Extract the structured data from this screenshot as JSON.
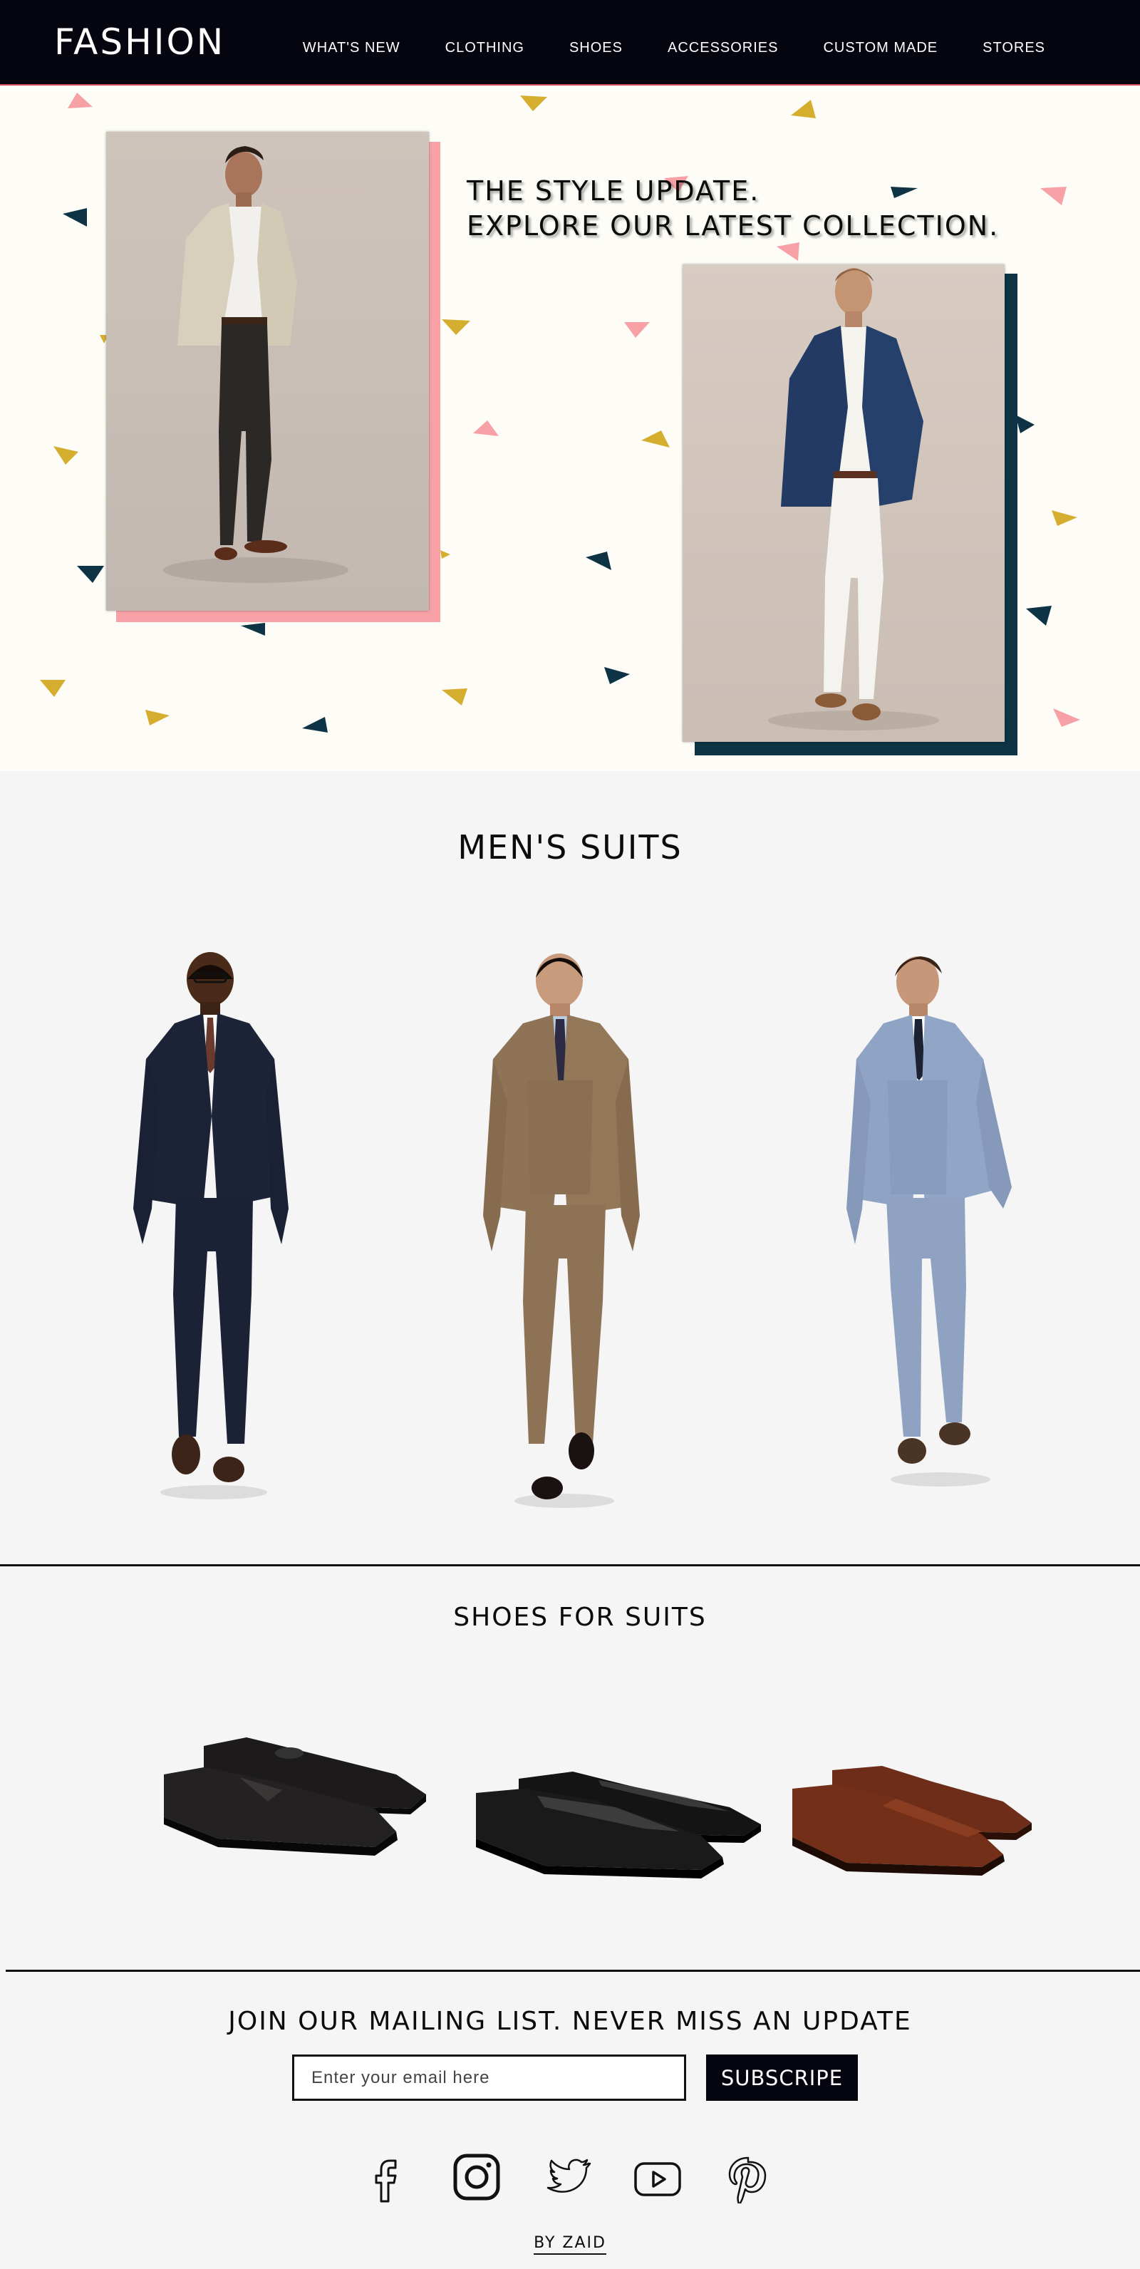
{
  "brand": {
    "logo": "FASHION"
  },
  "nav": {
    "items": [
      "WHAT'S NEW",
      "CLOTHING",
      "SHOES",
      "ACCESSORIES",
      "CUSTOM MADE",
      "STORES"
    ]
  },
  "hero": {
    "title_line1": "THE STYLE UPDATE.",
    "title_line2": "EXPLORE OUR LATEST COLLECTION."
  },
  "suits": {
    "title": "MEN'S SUITS"
  },
  "shoes": {
    "title": "SHOES FOR SUITS"
  },
  "mailing": {
    "title": "JOIN OUR MAILING LIST. NEVER MISS AN UPDATE",
    "placeholder": "Enter your email here",
    "button": "SUBSCRIPE"
  },
  "footer": {
    "credit": "BY ZAID"
  },
  "colors": {
    "nav_bg": "#05050f",
    "pink": "#f7a1a6",
    "gold": "#d6ae2f",
    "navy": "#0d3344",
    "hero_bg": "#fdfcf7"
  },
  "icons": [
    "facebook-icon",
    "instagram-icon",
    "twitter-icon",
    "youtube-icon",
    "pinterest-icon"
  ]
}
